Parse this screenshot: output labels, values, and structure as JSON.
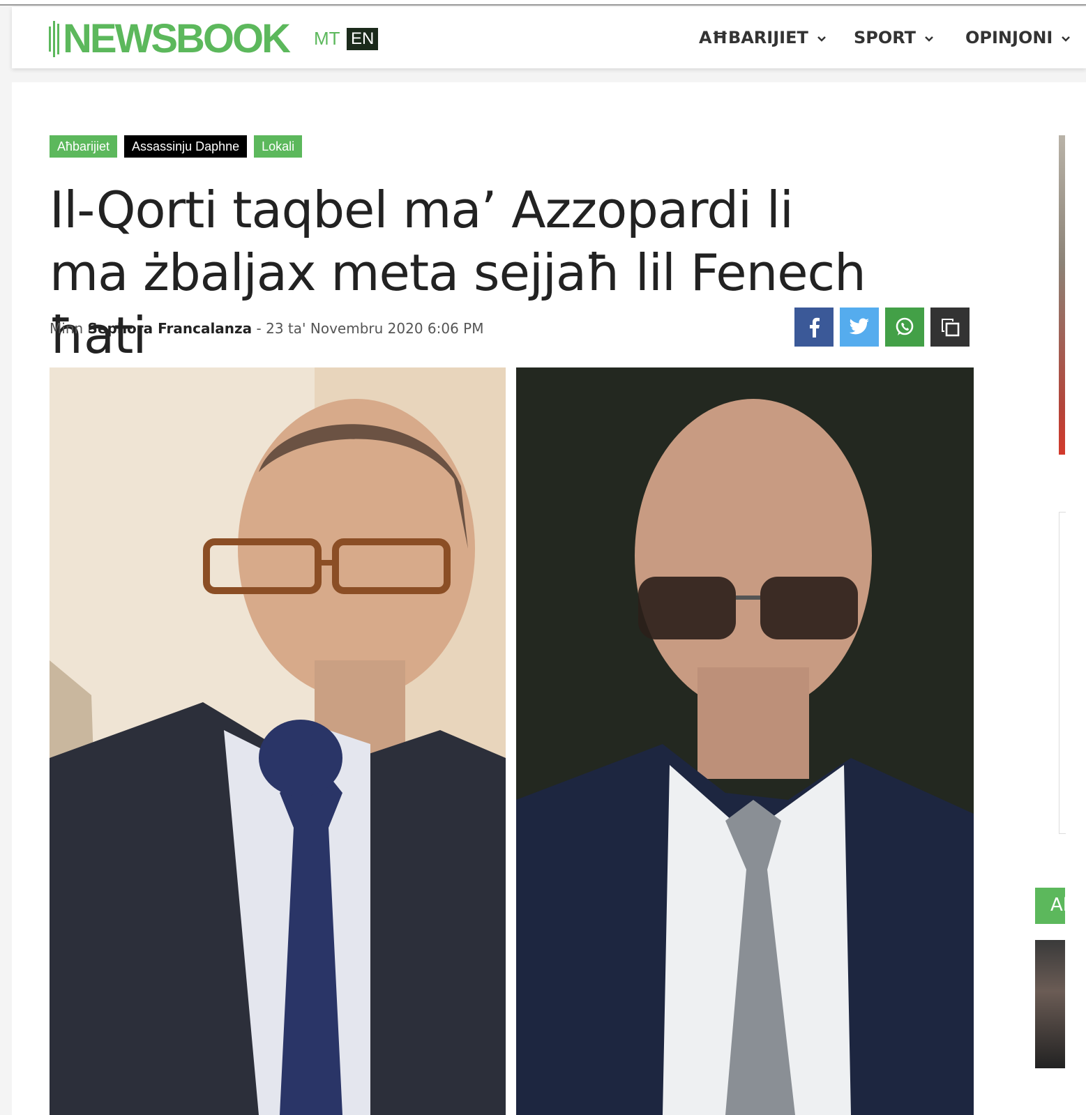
{
  "header": {
    "logo_text": "NEWSBOOK",
    "lang_mt": "MT",
    "lang_en": "EN",
    "nav": [
      {
        "label": "AĦBARIJIET"
      },
      {
        "label": "SPORT"
      },
      {
        "label": "OPINJONI"
      }
    ]
  },
  "article": {
    "tags": [
      "Aħbarijiet",
      "Assassinju Daphne",
      "Lokali"
    ],
    "title": "Il-Qorti taqbel ma’ Azzopardi li ma żbaljax meta sejjaħ lil Fenech ħati",
    "byline_prefix": "Minn",
    "author": "Sephora Francalanza",
    "separator": "-",
    "date": "23 ta' Novembru 2020 6:06 PM"
  },
  "share": {
    "buttons": [
      "facebook-icon",
      "twitter-icon",
      "whatsapp-icon",
      "copy-icon"
    ]
  },
  "sidebar": {
    "tab_label": "Al"
  },
  "colors": {
    "brand_green": "#5cb85c",
    "facebook": "#3b5998",
    "twitter": "#55acee",
    "whatsapp": "#43a047",
    "copy": "#333333"
  }
}
